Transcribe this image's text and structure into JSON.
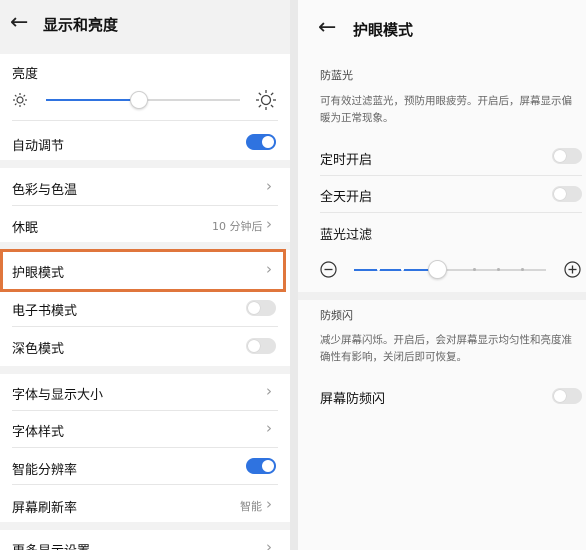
{
  "left": {
    "title": "显示和亮度",
    "brightness": {
      "label": "亮度",
      "level": 0.48
    },
    "auto_adjust": {
      "label": "自动调节",
      "on": true
    },
    "color_temp": {
      "label": "色彩与色温"
    },
    "sleep": {
      "label": "休眠",
      "value": "10 分钟后"
    },
    "eye_care": {
      "label": "护眼模式"
    },
    "ebook": {
      "label": "电子书模式",
      "on": false
    },
    "dark": {
      "label": "深色模式",
      "on": false
    },
    "font_size": {
      "label": "字体与显示大小"
    },
    "font_style": {
      "label": "字体样式"
    },
    "smart_res": {
      "label": "智能分辨率",
      "on": true
    },
    "refresh": {
      "label": "屏幕刷新率",
      "value": "智能"
    },
    "more": {
      "label": "更多显示设置"
    }
  },
  "right": {
    "title": "护眼模式",
    "blue_light": {
      "header": "防蓝光",
      "desc": "可有效过滤蓝光，预防用眼疲劳。开启后，屏幕显示偏暖为正常现象。",
      "scheduled": {
        "label": "定时开启",
        "on": false
      },
      "all_day": {
        "label": "全天开启",
        "on": false
      },
      "filter": {
        "label": "蓝光过滤",
        "level": 0.44
      }
    },
    "anti_flicker": {
      "header": "防频闪",
      "desc": "减少屏幕闪烁。开启后，会对屏幕显示均匀性和亮度准确性有影响，关闭后即可恢复。",
      "toggle": {
        "label": "屏幕防频闪",
        "on": false
      }
    }
  },
  "colors": {
    "accent": "#2f73e0",
    "highlight": "#e0763c"
  },
  "icons": [
    "back-arrow-icon",
    "sun-small-icon",
    "sun-large-icon",
    "chevron-right-icon",
    "minus-circle-icon",
    "plus-circle-icon"
  ]
}
